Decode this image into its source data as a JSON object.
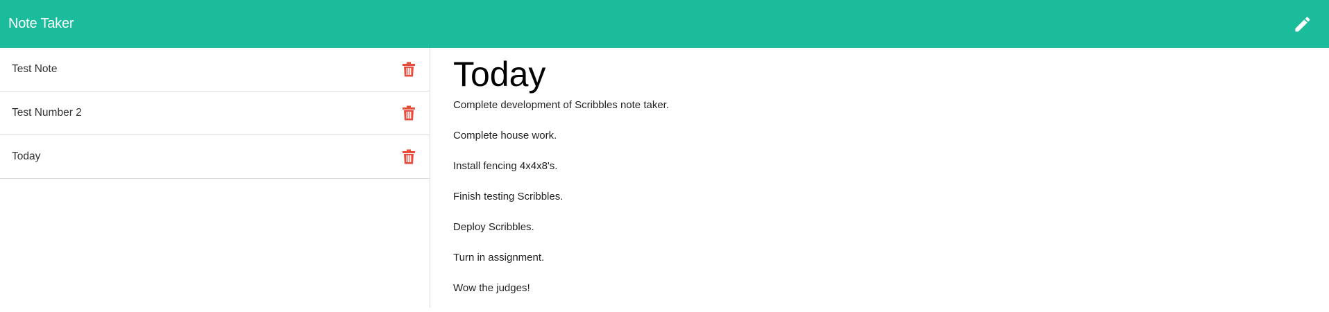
{
  "navbar": {
    "brand": "Note Taker",
    "icon": "pencil-icon",
    "color": "#1abc9c"
  },
  "sidebar": {
    "notes": [
      {
        "title": "Test Note",
        "icon": "trash-icon"
      },
      {
        "title": "Test Number 2",
        "icon": "trash-icon"
      },
      {
        "title": "Today",
        "icon": "trash-icon"
      }
    ],
    "delete_color": "#e74c3c"
  },
  "active_note": {
    "title": "Today",
    "lines": [
      "Complete development of Scribbles note taker.",
      "Complete house work.",
      "Install fencing 4x4x8's.",
      "Finish testing Scribbles.",
      "Deploy Scribbles.",
      "Turn in assignment.",
      "Wow the judges!"
    ]
  }
}
